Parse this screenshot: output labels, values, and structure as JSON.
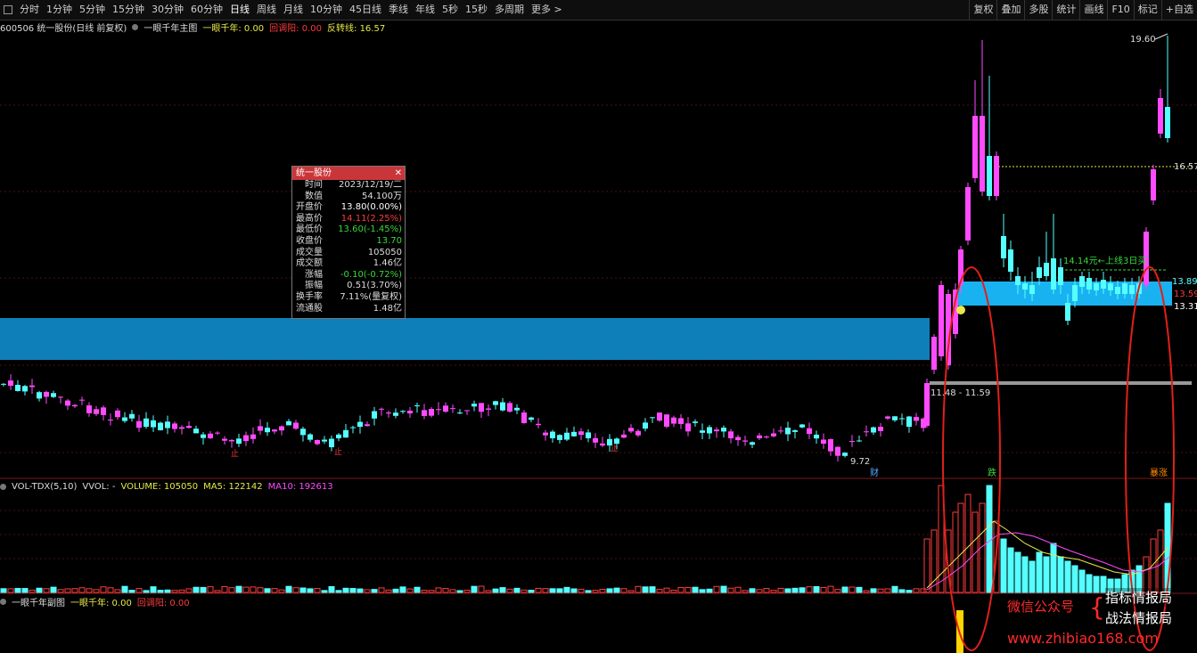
{
  "toolbar": {
    "periods": [
      "分时",
      "1分钟",
      "5分钟",
      "15分钟",
      "30分钟",
      "60分钟",
      "日线",
      "周线",
      "月线",
      "10分钟",
      "45日线",
      "季线",
      "年线",
      "5秒",
      "15秒",
      "多周期",
      "更多 >"
    ],
    "active_period": "日线",
    "right_buttons": [
      "复权",
      "叠加",
      "多股",
      "统计",
      "画线",
      "F10",
      "标记",
      "+自选"
    ]
  },
  "header": {
    "stock": "600506 统一股份(日线 前复权)",
    "indicator_name": "一眼千年主图",
    "k1_label": "一眼千年:",
    "k1_value": "0.00",
    "k2_label": "回调阳:",
    "k2_value": "0.00",
    "k3_label": "反转线:",
    "k3_value": "16.57"
  },
  "price_labels": {
    "high": "19.60",
    "reversal": "16.57",
    "band_top": "13.89",
    "band_mid": "13.59",
    "band_bot": "13.31",
    "low": "9.72",
    "gray_line": "11.48 - 11.59",
    "annotation": "14.14元←上线3日买"
  },
  "markers": {
    "cai": "财",
    "die": "跌",
    "zhang": "暴涨",
    "zhi": "止"
  },
  "popup": {
    "title": "统一股份",
    "rows": [
      {
        "label": "时间",
        "value": "2023/12/19/二",
        "color": "#ddd"
      },
      {
        "label": "数值",
        "value": "54.100万",
        "color": "#ddd"
      },
      {
        "label": "开盘价",
        "value": "13.80(0.00%)",
        "color": "#fff"
      },
      {
        "label": "最高价",
        "value": "14.11(2.25%)",
        "color": "#ff3b3b"
      },
      {
        "label": "最低价",
        "value": "13.60(-1.45%)",
        "color": "#39d839"
      },
      {
        "label": "收盘价",
        "value": "13.70",
        "color": "#39d839"
      },
      {
        "label": "成交量",
        "value": "105050",
        "color": "#ddd"
      },
      {
        "label": "成交额",
        "value": "1.46亿",
        "color": "#ddd"
      },
      {
        "label": "涨幅",
        "value": "-0.10(-0.72%)",
        "color": "#39d839"
      },
      {
        "label": "振幅",
        "value": "0.51(3.70%)",
        "color": "#ddd"
      },
      {
        "label": "换手率",
        "value": "7.11%(量复权)",
        "color": "#ddd"
      },
      {
        "label": "流通股",
        "value": "1.48亿",
        "color": "#ddd"
      }
    ]
  },
  "volume_header": {
    "name": "VOL-TDX(5,10)",
    "vvol": "VVOL: -",
    "volume": "VOLUME: 105050",
    "ma5": "MA5: 122142",
    "ma10": "MA10: 192613"
  },
  "sub_header": {
    "name": "一眼千年副图",
    "k1": "一眼千年: 0.00",
    "k2": "回调阳: 0.00"
  },
  "watermark": {
    "line1": "微信公众号",
    "line2": "指标情报局",
    "line3": "战法情报局",
    "url": "www.zhibiao168.com"
  },
  "colors": {
    "up": "#ff4bff",
    "down": "#5ff",
    "band": "#0e7fb8",
    "bg": "#000"
  }
}
